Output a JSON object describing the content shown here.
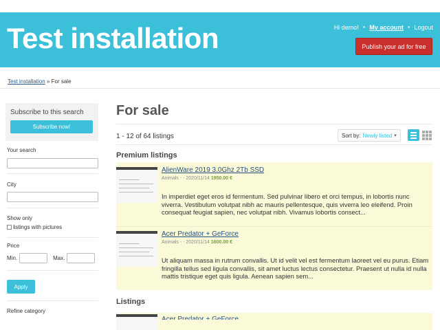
{
  "header": {
    "site_title": "Test installation",
    "greeting": "Hi demo!",
    "my_account": "My account",
    "logout": "Logout",
    "publish_button": "Publish your ad for free",
    "bg_color": "#3cbfd8"
  },
  "breadcrumb": {
    "home": "Test installation",
    "separator": "»",
    "current": "For sale"
  },
  "sidebar": {
    "subscribe_title": "Subscribe to this search",
    "subscribe_button": "Subscribe now!",
    "your_search_label": "Your search",
    "city_label": "City",
    "show_only_label": "Show only",
    "pictures_checkbox_label": "listings with pictures",
    "price_label": "Price",
    "min_label": "Min.",
    "max_label": "Max.",
    "apply_button": "Apply",
    "refine_category_label": "Refine category"
  },
  "main": {
    "title": "For sale",
    "count_text": "1 - 12 of 64 listings",
    "sort_label": "Sort by:",
    "sort_value": "Newly listed",
    "premium_heading": "Premium listings",
    "listings_heading": "Listings",
    "premium_items": [
      {
        "title": "AlienWare 2019 3.0Ghz 2Tb SSD",
        "meta": "Animals - - 2020/11/14",
        "price": "1950.00 €",
        "description": "In imperdiet eget eros id fermentum. Sed pulvinar libero et orci tempus, in lobortis nunc viverra. Vestibulum volutpat nibh ac mauris pellentesque, quis viverra leo eleifend. Proin consequat feugiat sapien, nec volutpat nibh. Vivamus lobortis consect..."
      },
      {
        "title": "Acer Predator + GeForce",
        "meta": "Animals - - 2020/11/14",
        "price": "1600.00 €",
        "description": "Ut aliquam massa in rutrum convallis. Ut id velit vel est fermentum laoreet vel eu purus. Etiam fringilla tellus sed ligula convallis, sit amet luctus lectus consectetur. Praesent ut nulla id nulla mattis tristique eget quis ligula. Aenean sapien sem..."
      }
    ],
    "listing_peek_title": "Acer Predator + GeForce"
  }
}
